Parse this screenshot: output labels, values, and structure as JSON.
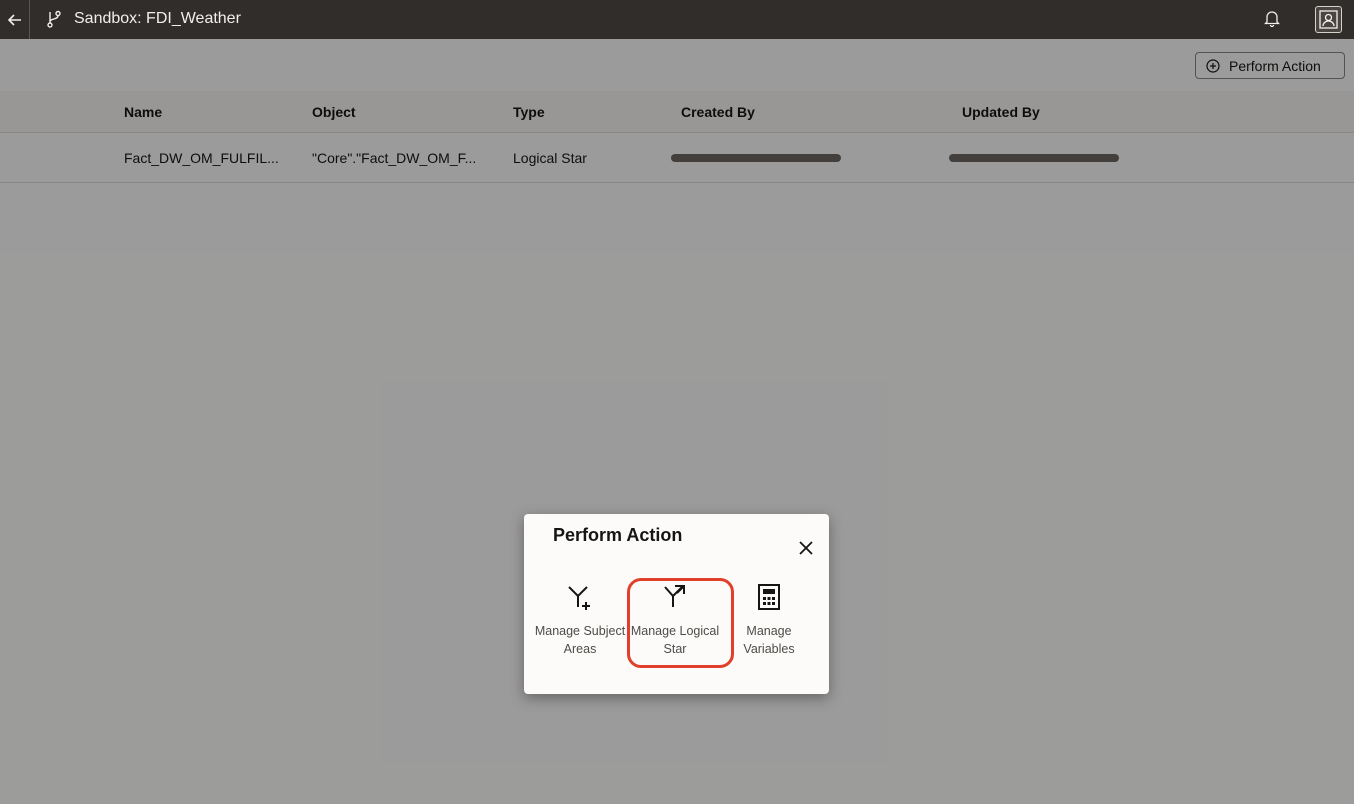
{
  "header": {
    "back_icon": "arrow-left-icon",
    "branch_icon": "branch-icon",
    "sandbox_title": "Sandbox: FDI_Weather",
    "bell_icon": "bell-icon",
    "user_icon": "user-icon"
  },
  "toolbar": {
    "perform_action_label": "Perform Action",
    "plus_icon": "plus-circle-icon"
  },
  "table": {
    "columns": [
      "Name",
      "Object",
      "Type",
      "Created By",
      "Updated By"
    ],
    "rows": [
      {
        "name": "Fact_DW_OM_FULFIL...",
        "object": "\"Core\".\"Fact_DW_OM_F...",
        "type": "Logical Star",
        "created_by": "",
        "updated_by": ""
      }
    ]
  },
  "dialog": {
    "title": "Perform Action",
    "close_icon": "close-icon",
    "actions": [
      {
        "label_line1": "Manage Subject",
        "label_line2": "Areas",
        "icon": "subject-area-icon"
      },
      {
        "label_line1": "Manage Logical",
        "label_line2": "Star",
        "icon": "logical-star-icon"
      },
      {
        "label_line1": "Manage",
        "label_line2": "Variables",
        "icon": "calculator-icon"
      }
    ],
    "highlight_color": "#e0402a"
  }
}
